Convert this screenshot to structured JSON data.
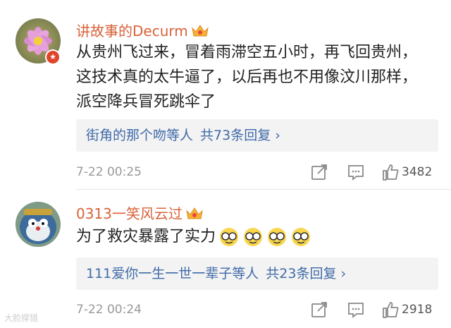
{
  "comments": [
    {
      "username": "讲故事的Decurm",
      "text_lines": [
        "从贵州飞过来，冒着雨滞空五小时，再飞回贵州，",
        "这技术真的太牛逼了，以后再也不用像汶川那样，",
        "派空降兵冒死跳伞了"
      ],
      "reply_users": "街角的那个吻等人",
      "reply_count_text": "共73条回复",
      "time": "7-22 00:25",
      "likes": "3482",
      "icons": {
        "share": "share-icon",
        "comment": "comment-icon",
        "like": "thumbs-up-icon"
      }
    },
    {
      "username": "0313一笑风云过",
      "text": "为了救灾暴露了实力",
      "reply_users": "111爱你一生一世一辈子等人",
      "reply_count_text": "共23条回复",
      "time": "7-22 00:24",
      "likes": "2918",
      "icons": {
        "share": "share-icon",
        "comment": "comment-icon",
        "like": "thumbs-up-icon"
      }
    }
  ],
  "watermark": "大脸撑猎",
  "colors": {
    "username": "#d9623a",
    "reply_link": "#3f6aa8",
    "meta": "#999999",
    "reply_bg": "#f3f3f3"
  }
}
